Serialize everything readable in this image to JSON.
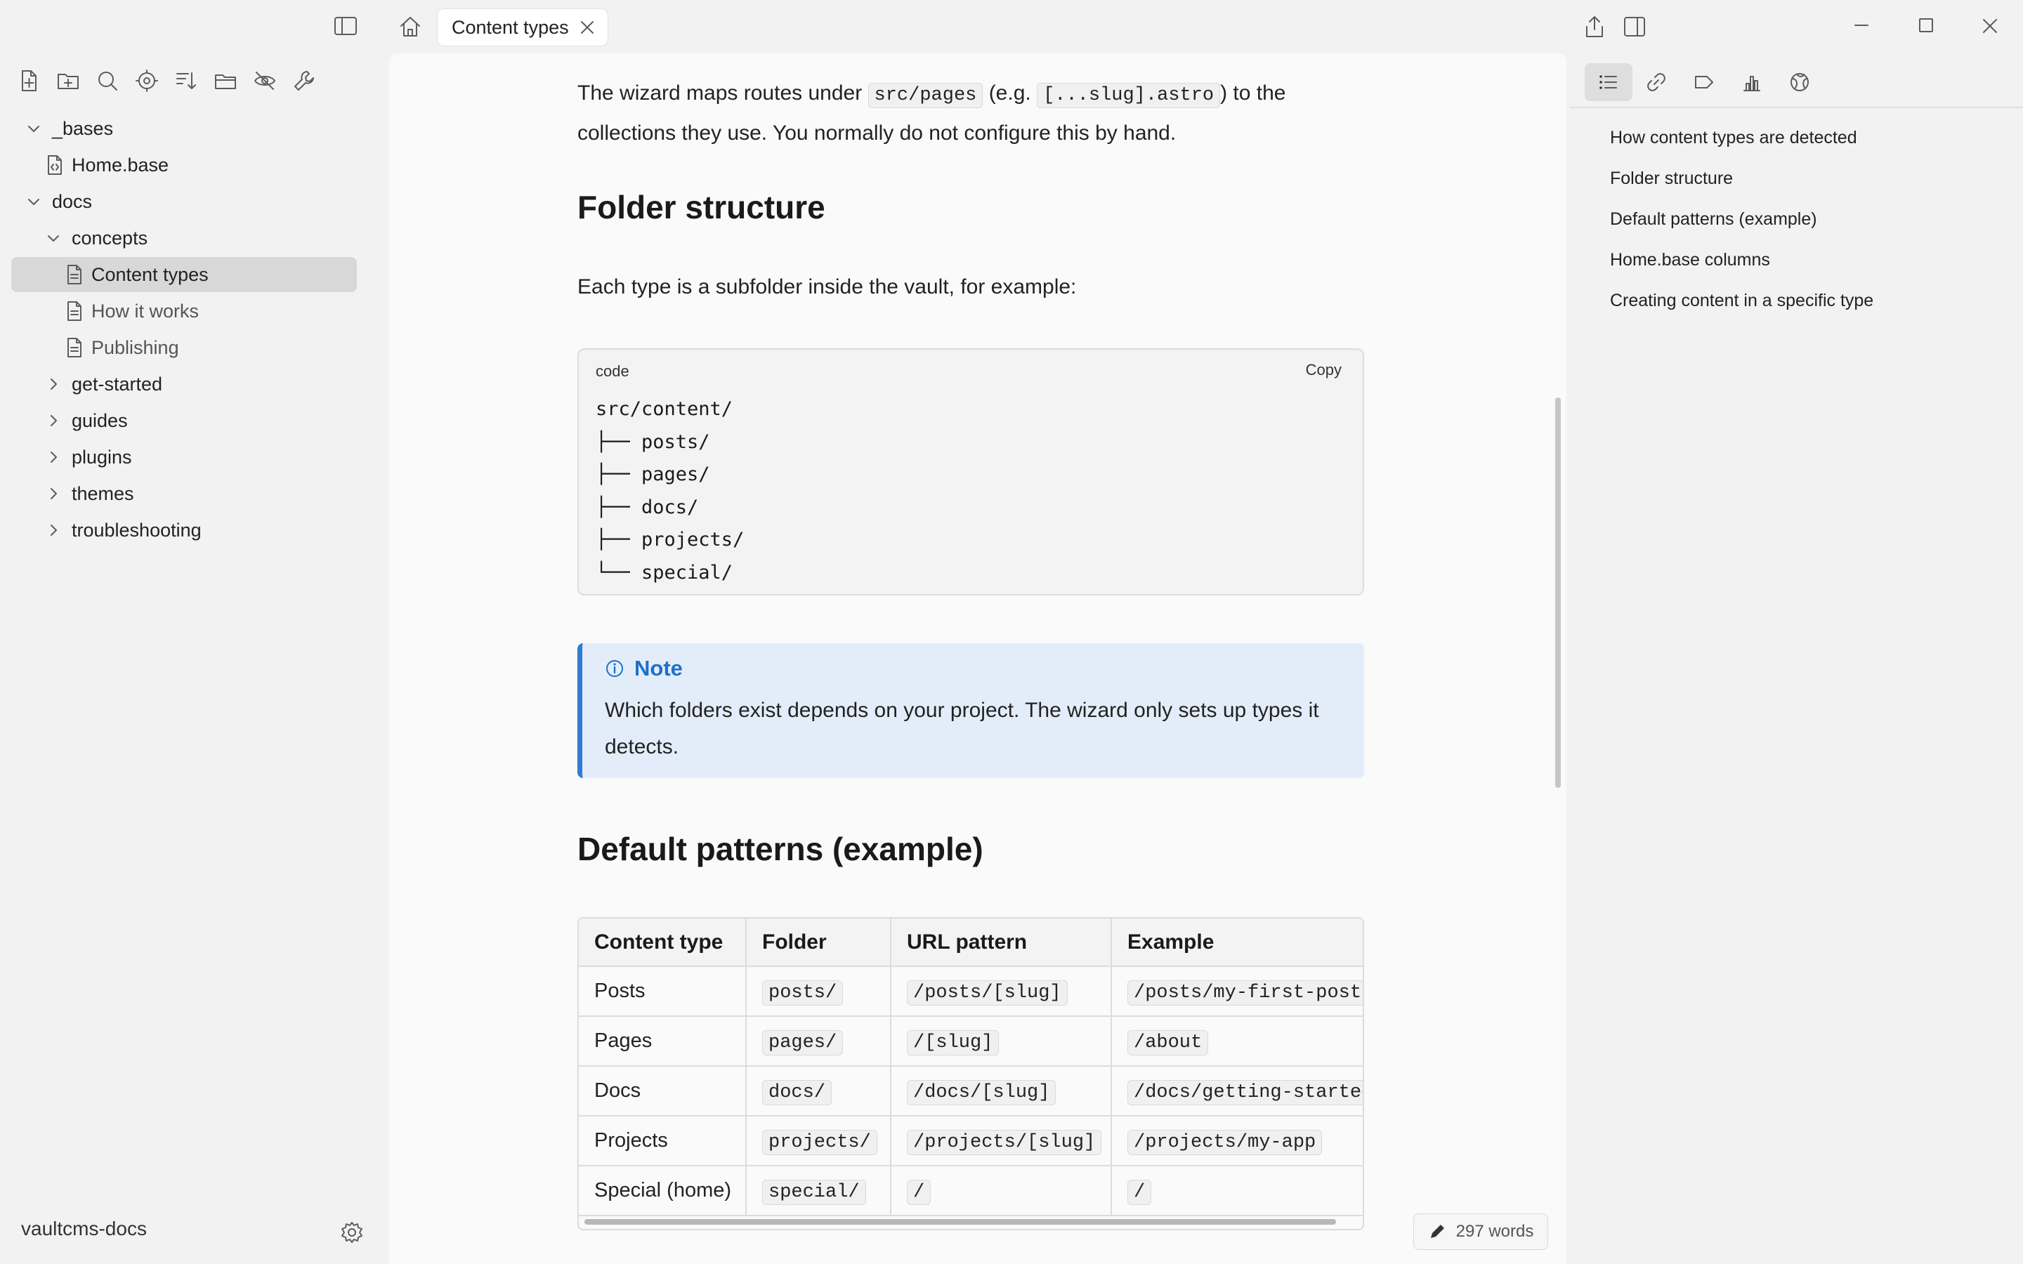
{
  "tab": {
    "title": "Content types"
  },
  "sidebar": {
    "tree": [
      {
        "label": "_bases",
        "kind": "folder",
        "expanded": true,
        "depth": 0
      },
      {
        "label": "Home.base",
        "kind": "base-file",
        "depth": 1
      },
      {
        "label": "docs",
        "kind": "folder",
        "expanded": true,
        "depth": 0
      },
      {
        "label": "concepts",
        "kind": "folder",
        "expanded": true,
        "depth": 1
      },
      {
        "label": "Content types",
        "kind": "file",
        "depth": 2,
        "active": true
      },
      {
        "label": "How it works",
        "kind": "file",
        "depth": 2
      },
      {
        "label": "Publishing",
        "kind": "file",
        "depth": 2
      },
      {
        "label": "get-started",
        "kind": "folder",
        "expanded": false,
        "depth": 1
      },
      {
        "label": "guides",
        "kind": "folder",
        "expanded": false,
        "depth": 1
      },
      {
        "label": "plugins",
        "kind": "folder",
        "expanded": false,
        "depth": 1
      },
      {
        "label": "themes",
        "kind": "folder",
        "expanded": false,
        "depth": 1
      },
      {
        "label": "troubleshooting",
        "kind": "folder",
        "expanded": false,
        "depth": 1
      }
    ],
    "vault_name": "vaultcms-docs"
  },
  "doc": {
    "intro": {
      "t1": "The wizard maps routes under ",
      "c1": "src/pages",
      "t2": " (e.g. ",
      "c2": "[...slug].astro",
      "t3": ") to the collections they use. You normally do not configure this by hand."
    },
    "h_folder": "Folder structure",
    "folder_text": "Each type is a subfolder inside the vault, for example:",
    "code": {
      "lang": "code",
      "copy_label": "Copy",
      "lines": [
        "src/content/",
        "├── posts/",
        "├── pages/",
        "├── docs/",
        "├── projects/",
        "└── special/"
      ]
    },
    "note": {
      "title": "Note",
      "text": "Which folders exist depends on your project. The wizard only sets up types it detects."
    },
    "h_patterns": "Default patterns (example)",
    "table": {
      "headers": [
        "Content type",
        "Folder",
        "URL pattern",
        "Example"
      ],
      "rows": [
        [
          "Posts",
          "posts/",
          "/posts/[slug]",
          "/posts/my-first-post"
        ],
        [
          "Pages",
          "pages/",
          "/[slug]",
          "/about"
        ],
        [
          "Docs",
          "docs/",
          "/docs/[slug]",
          "/docs/getting-started"
        ],
        [
          "Projects",
          "projects/",
          "/projects/[slug]",
          "/projects/my-app"
        ],
        [
          "Special (home)",
          "special/",
          "/",
          "/"
        ]
      ]
    }
  },
  "status": {
    "word_count": "297 words"
  },
  "outline": {
    "items": [
      "How content types are detected",
      "Folder structure",
      "Default patterns (example)",
      "Home.base columns",
      "Creating content in a specific type"
    ]
  },
  "colors": {
    "accent": "#2f7dd3",
    "callout_bg": "#e3edf9",
    "active_row": "#d8d8d8"
  }
}
